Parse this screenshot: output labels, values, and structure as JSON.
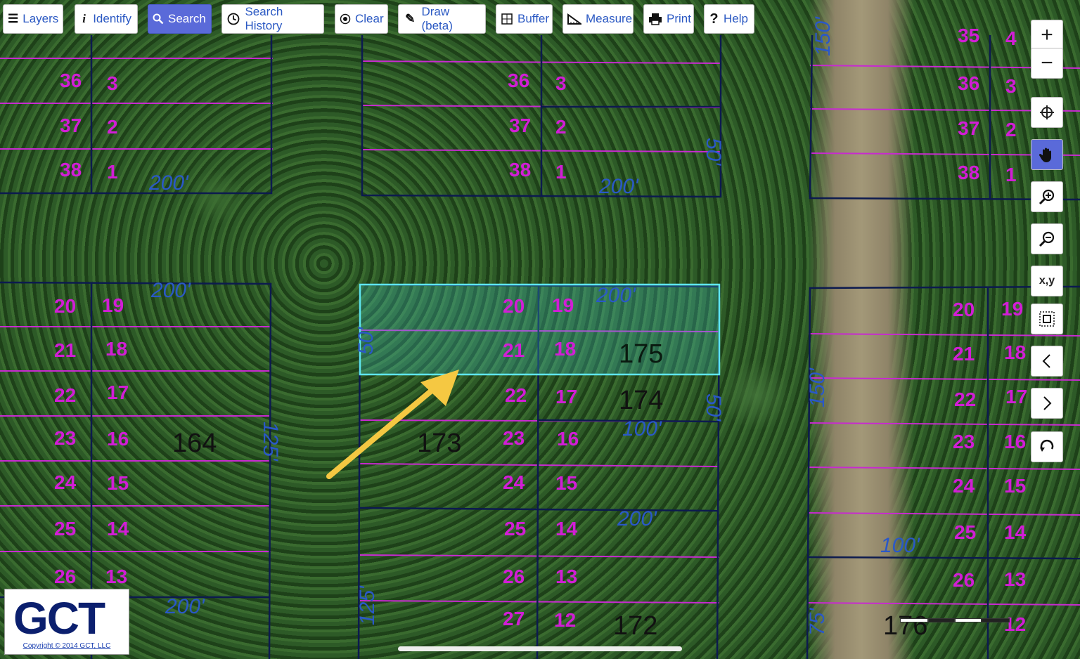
{
  "toolbar": {
    "layers": "Layers",
    "identify": "Identify",
    "search": "Search",
    "search_history": "Search History",
    "clear": "Clear",
    "draw": "Draw (beta)",
    "buffer": "Buffer",
    "measure": "Measure",
    "print": "Print",
    "help": "Help"
  },
  "right_tools": {
    "zoom_in": "+",
    "zoom_out": "−",
    "xy": "x,y"
  },
  "map": {
    "blocks": {
      "b164": "164",
      "b173": "173",
      "b174": "174",
      "b175": "175",
      "b172": "172",
      "b176": "176"
    },
    "dims": {
      "d200": "200'",
      "d100": "100'",
      "d150": "150'",
      "d125": "125'",
      "d75": "75'",
      "d50": "50'"
    }
  },
  "logo": {
    "text": "GCT",
    "copyright": "Copyright © 2014 GCT, LLC"
  },
  "colors": {
    "lot_label": "#d21dd6",
    "parcel_line": "#0c1a4f",
    "dimension": "#2a58c8",
    "selection": "#5fe6f0",
    "arrow": "#f5c842",
    "active_button": "#5a6ad9"
  }
}
